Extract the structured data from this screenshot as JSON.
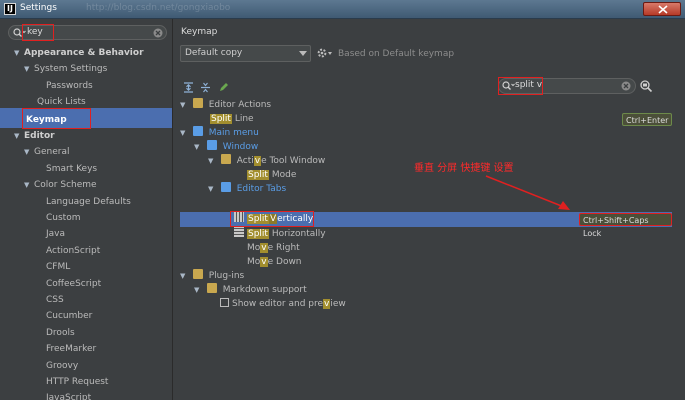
{
  "window": {
    "title": "Settings",
    "ghost_title": "http://blog.csdn.net/gongxiaobo"
  },
  "sidebar": {
    "search_value": "key",
    "items": [
      {
        "label": "Appearance & Behavior",
        "level": 0,
        "expanded": true,
        "bold": true
      },
      {
        "label": "System Settings",
        "level": 1,
        "expanded": true
      },
      {
        "label": "Passwords",
        "level": 2
      },
      {
        "label": "Quick Lists",
        "level": 1
      },
      {
        "label": "Keymap",
        "level": 0,
        "bold": true,
        "selected": true
      },
      {
        "label": "Editor",
        "level": 0,
        "expanded": true,
        "bold": true
      },
      {
        "label": "General",
        "level": 1,
        "expanded": true
      },
      {
        "label": "Smart Keys",
        "level": 2
      },
      {
        "label": "Color Scheme",
        "level": 1,
        "expanded": true
      },
      {
        "label": "Language Defaults",
        "level": 2
      },
      {
        "label": "Custom",
        "level": 2
      },
      {
        "label": "Java",
        "level": 2
      },
      {
        "label": "ActionScript",
        "level": 2
      },
      {
        "label": "CFML",
        "level": 2
      },
      {
        "label": "CoffeeScript",
        "level": 2
      },
      {
        "label": "CSS",
        "level": 2
      },
      {
        "label": "Cucumber",
        "level": 2
      },
      {
        "label": "Drools",
        "level": 2
      },
      {
        "label": "FreeMarker",
        "level": 2
      },
      {
        "label": "Groovy",
        "level": 2
      },
      {
        "label": "HTTP Request",
        "level": 2
      },
      {
        "label": "JavaScript",
        "level": 2
      }
    ]
  },
  "main": {
    "title": "Keymap",
    "keymap_select": "Default copy",
    "based_on": "Based on Default keymap",
    "search_value": "split v",
    "tree": {
      "editor_actions": "Editor Actions",
      "split_line_hl": "Split",
      "split_line_rest": " Line",
      "split_line_shortcut": "Ctrl+Enter",
      "main_menu": "Main menu",
      "window": "Window",
      "active_pre": "Acti",
      "active_hl": "v",
      "active_post": "e Tool Window",
      "split_mode_hl": "Split",
      "split_mode_rest": " Mode",
      "editor_tabs": "Editor Tabs",
      "split_vert_hl1": "Split",
      "split_vert_hl2": "V",
      "split_vert_rest": "ertically",
      "split_vert_shortcut": "Ctrl+Shift+Caps Lock",
      "split_horiz_hl": "Split",
      "split_horiz_rest": " Horizontally",
      "move_right_pre": "Mo",
      "move_right_hl": "v",
      "move_right_post": "e Right",
      "move_down_pre": "Mo",
      "move_down_hl": "v",
      "move_down_post": "e Down",
      "plugins": "Plug-ins",
      "markdown": "Markdown support",
      "show_pre": "Show editor and pre",
      "show_hl": "v",
      "show_post": "iew"
    }
  },
  "annotation": {
    "text": "垂直 分屏 快捷键 设置",
    "color": "#ff2a2a"
  }
}
